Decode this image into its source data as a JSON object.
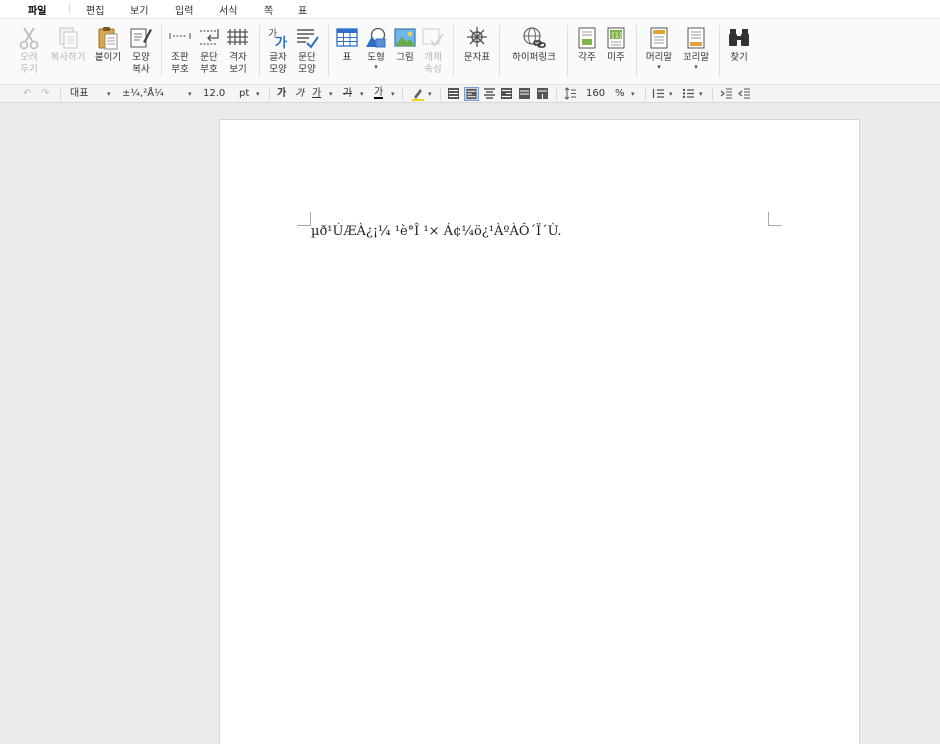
{
  "menubar": {
    "items": [
      {
        "label": "파일",
        "active": true
      },
      {
        "label": "편집"
      },
      {
        "label": "보기"
      },
      {
        "label": "입력"
      },
      {
        "label": "서식"
      },
      {
        "label": "쪽"
      },
      {
        "label": "표"
      }
    ]
  },
  "ribbon": {
    "cut": {
      "label": "오려\n두기",
      "icon": "scissors-icon",
      "enabled": false
    },
    "copy": {
      "label": "복사하기",
      "icon": "copy-icon",
      "enabled": false
    },
    "paste": {
      "label": "붙이기",
      "icon": "clipboard-icon",
      "enabled": true
    },
    "format_copy": {
      "label": "모양\n복사",
      "icon": "format-painter-icon",
      "enabled": true
    },
    "layout_marks": {
      "label": "조판\n부호",
      "icon": "layout-marks-icon"
    },
    "para_marks": {
      "label": "문단\n부호",
      "icon": "paragraph-marks-icon"
    },
    "grid_view": {
      "label": "격자\n보기",
      "icon": "grid-icon"
    },
    "char_shape": {
      "label": "글자\n모양",
      "icon": "char-shape-icon"
    },
    "para_shape": {
      "label": "문단\n모양",
      "icon": "para-shape-icon"
    },
    "table": {
      "label": "표",
      "icon": "table-icon"
    },
    "shape": {
      "label": "도형",
      "icon": "shapes-icon"
    },
    "picture": {
      "label": "그림",
      "icon": "picture-icon"
    },
    "object_props": {
      "label": "개체\n속성",
      "icon": "object-props-icon",
      "enabled": false
    },
    "symbol": {
      "label": "문자표",
      "icon": "symbol-icon"
    },
    "hyperlink": {
      "label": "하이퍼링크",
      "icon": "hyperlink-icon"
    },
    "footnote": {
      "label": "각주",
      "icon": "footnote-icon"
    },
    "endnote": {
      "label": "미주",
      "icon": "endnote-icon"
    },
    "header": {
      "label": "머리말",
      "icon": "header-icon"
    },
    "footer": {
      "label": "꼬리말",
      "icon": "footer-icon"
    },
    "find": {
      "label": "찾기",
      "icon": "binoculars-icon"
    }
  },
  "format": {
    "style": "대표",
    "font": "±¼,²Å¼",
    "size": "12.0",
    "unit": "pt",
    "line_spacing": "160",
    "line_spacing_unit": "%",
    "bold_glyph": "가",
    "italic_glyph": "가",
    "underline_glyph": "가",
    "strike_glyph": "가",
    "color_glyph": "가"
  },
  "document": {
    "text": "µð¹ÚÆÀ¿¡¼­ ¹è°Î ¹× Á¢¼ö¿¹ÀºÀÔ´Ï´Ù."
  },
  "colors": {
    "accent": "#2d6fc9",
    "page_bg": "#ebebeb"
  }
}
